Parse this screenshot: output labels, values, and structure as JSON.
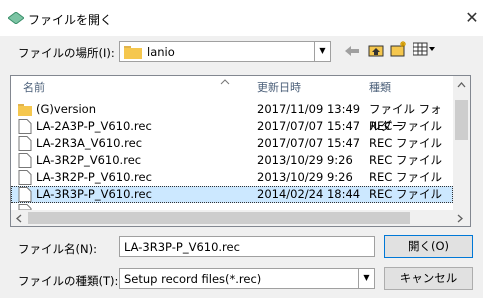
{
  "window": {
    "title": "ファイルを開く",
    "close_glyph": "✕"
  },
  "location": {
    "label": "ファイルの場所(I):",
    "value": "lanio",
    "icons": [
      "back-arrow-icon",
      "up-folder-icon",
      "new-folder-icon",
      "view-menu-icon"
    ]
  },
  "list": {
    "columns": {
      "name": "名前",
      "date": "更新日時",
      "type": "種類"
    },
    "rows": [
      {
        "name": "(G)version",
        "date": "2017/11/09 13:49",
        "type": "ファイル フォルダー",
        "icon": "folder-icon"
      },
      {
        "name": "LA-2A3P-P_V610.rec",
        "date": "2017/07/07 15:47",
        "type": "REC ファイル",
        "icon": "file-icon"
      },
      {
        "name": "LA-2R3A_V610.rec",
        "date": "2017/07/07 15:47",
        "type": "REC ファイル",
        "icon": "file-icon"
      },
      {
        "name": "LA-3R2P_V610.rec",
        "date": "2013/10/29 9:26",
        "type": "REC ファイル",
        "icon": "file-icon"
      },
      {
        "name": "LA-3R2P-P_V610.rec",
        "date": "2013/10/29 9:26",
        "type": "REC ファイル",
        "icon": "file-icon"
      },
      {
        "name": "LA-3R3P-P_V610.rec",
        "date": "2014/02/24 18:44",
        "type": "REC ファイル",
        "icon": "file-icon",
        "selected": true
      }
    ]
  },
  "filename": {
    "label": "ファイル名(N):",
    "value": "LA-3R3P-P_V610.rec"
  },
  "filetype": {
    "label": "ファイルの種類(T):",
    "value": "Setup record files(*.rec)"
  },
  "buttons": {
    "open": "開く(O)",
    "cancel": "キャンセル"
  }
}
